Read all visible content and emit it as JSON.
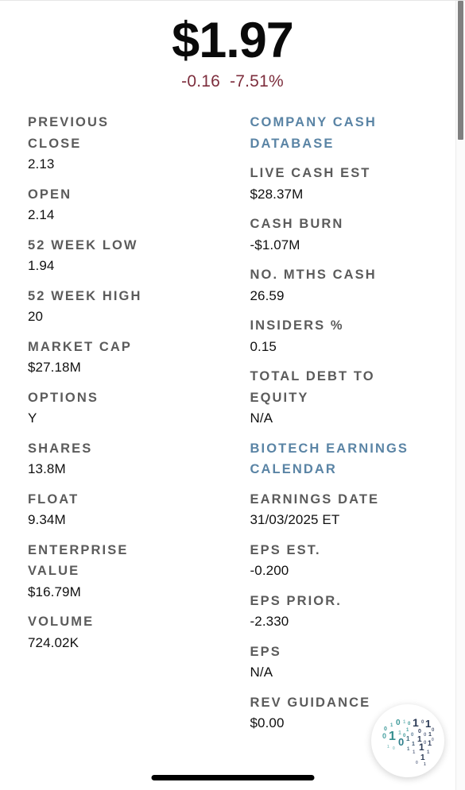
{
  "quote": {
    "price": "$1.97",
    "change_absolute": "-0.16",
    "change_percent": "-7.51%",
    "change_color": "#7d2e3d"
  },
  "left_column": [
    {
      "label": "PREVIOUS CLOSE",
      "value": "2.13"
    },
    {
      "label": "OPEN",
      "value": "2.14"
    },
    {
      "label": "52 WEEK LOW",
      "value": "1.94"
    },
    {
      "label": "52 WEEK HIGH",
      "value": "20"
    },
    {
      "label": "MARKET CAP",
      "value": "$27.18M"
    },
    {
      "label": "OPTIONS",
      "value": "Y"
    },
    {
      "label": "SHARES",
      "value": "13.8M"
    },
    {
      "label": "FLOAT",
      "value": "9.34M"
    },
    {
      "label": "ENTERPRISE VALUE",
      "value": "$16.79M"
    },
    {
      "label": "VOLUME",
      "value": "724.02K"
    }
  ],
  "right_column": {
    "section_one": {
      "heading": "COMPANY CASH DATABASE",
      "heading_color": "#5a84a5",
      "rows": [
        {
          "label": "LIVE CASH EST",
          "value": "$28.37M"
        },
        {
          "label": "CASH BURN",
          "value": "-$1.07M"
        },
        {
          "label": "NO. MTHS CASH",
          "value": "26.59"
        },
        {
          "label": "INSIDERS %",
          "value": "0.15"
        },
        {
          "label": "TOTAL DEBT TO EQUITY",
          "value": "N/A"
        }
      ]
    },
    "section_two": {
      "heading": "BIOTECH EARNINGS CALENDAR",
      "heading_color": "#5a84a5",
      "rows": [
        {
          "label": "EARNINGS DATE",
          "value": "31/03/2025 ET"
        },
        {
          "label": "EPS EST.",
          "value": "-0.200"
        },
        {
          "label": "EPS PRIOR.",
          "value": "-2.330"
        },
        {
          "label": "EPS",
          "value": "N/A"
        },
        {
          "label": "REV GUIDANCE",
          "value": "$0.00"
        }
      ]
    }
  },
  "badge": {
    "icon_name": "binary-brain-icon",
    "color_teal": "#3f9a9a",
    "color_navy": "#2b3a55",
    "background": "#ffffff"
  }
}
